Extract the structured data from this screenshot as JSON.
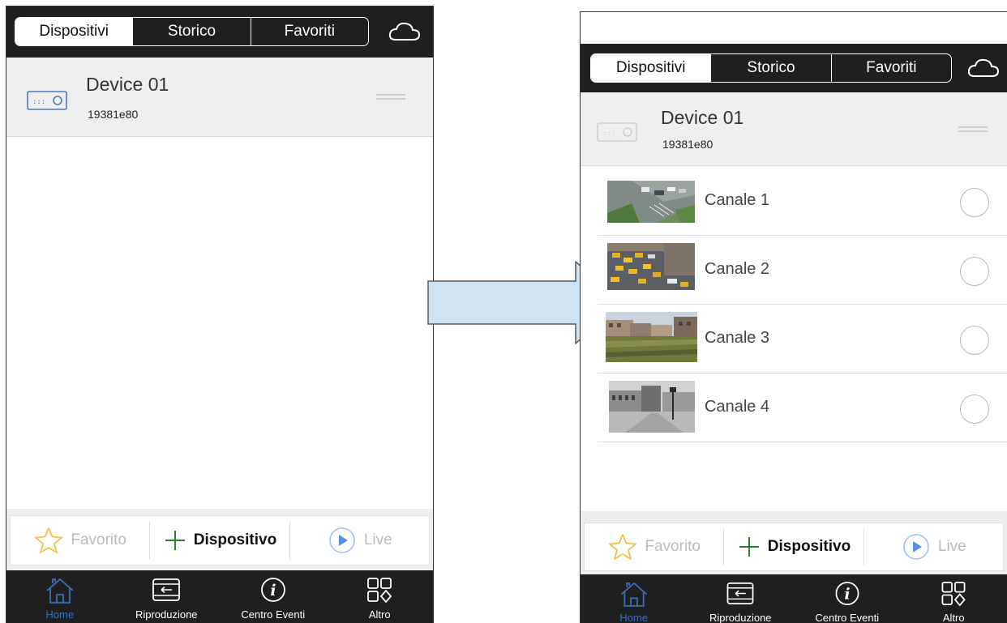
{
  "segmented": {
    "devices": "Dispositivi",
    "history": "Storico",
    "favorites": "Favoriti"
  },
  "device": {
    "name": "Device 01",
    "id": "19381e80"
  },
  "channels": [
    {
      "label": "Canale 1"
    },
    {
      "label": "Canale 2"
    },
    {
      "label": "Canale 3"
    },
    {
      "label": "Canale 4"
    }
  ],
  "actions": {
    "favorite": "Favorito",
    "add_device": "Dispositivo",
    "live": "Live"
  },
  "tabs": {
    "home": "Home",
    "playback": "Riproduzione",
    "events": "Centro Eventi",
    "more": "Altro"
  },
  "icons": [
    "cloud-icon",
    "device-icon",
    "drag-handle-icon",
    "star-icon",
    "plus-icon",
    "play-icon",
    "home-icon",
    "playback-icon",
    "info-icon",
    "more-icon",
    "arrow-icon"
  ],
  "colors": {
    "bar": "#1f1f1f",
    "accent": "#3d6fb8",
    "action_accent": "#5a8ee0",
    "star": "#f0c24a",
    "plus": "#2e7d32",
    "arrow_fill": "#cfe2f1",
    "arrow_stroke": "#5a5a5a"
  }
}
